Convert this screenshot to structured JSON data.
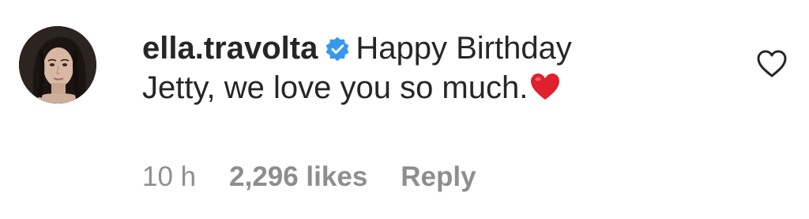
{
  "comment": {
    "username": "ella.travolta",
    "text_line1": "Happy Birthday",
    "text_line2": "Jetty, we love you so much.",
    "emoji": "heart-emoji"
  },
  "meta": {
    "time": "10 h",
    "likes": "2,296 likes",
    "reply": "Reply"
  },
  "icons": {
    "verified": "verified-badge-icon",
    "like": "heart-outline-icon"
  },
  "colors": {
    "text": "#262626",
    "secondary": "#8e8e8e",
    "verified": "#3897f0",
    "heart_emoji": "#e0202d"
  }
}
